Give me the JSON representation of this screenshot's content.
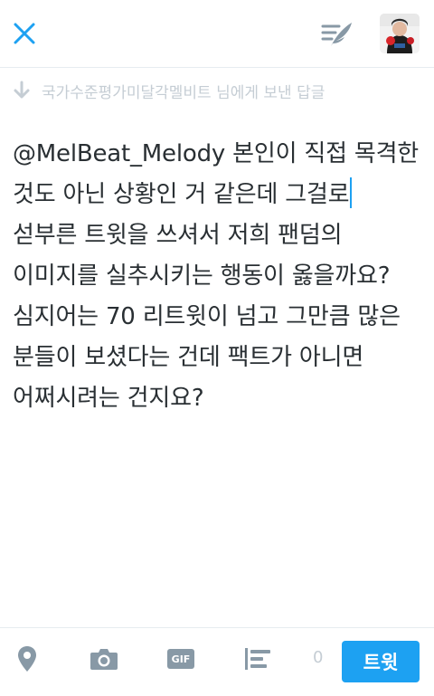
{
  "header": {
    "close_icon": "close-icon",
    "drafts_icon": "drafts-quill-icon",
    "avatar_icon": "user-avatar"
  },
  "reply_to": {
    "icon": "reply-arrow-icon",
    "text": "국가수준평가미달각멜비트 님에게 보낸 답글"
  },
  "compose": {
    "mention": "@MelBeat_Melody",
    "text_line1_rest": " 본인이 직접 목격한",
    "text_line2": "것도 아닌 상황인 거 같은데 그걸로",
    "text_line3": "섣부른 트윗을 쓰셔서 저희 팬덤의",
    "text_line4": "이미지를 실추시키는 행동이 옳을까요?",
    "text_line5": "심지어는 70 리트윗이 넘고 그만큼 많은",
    "text_line6": "분들이 보셨다는 건데 팩트가 아니면",
    "text_line7": "어쩌시려는 건지요?"
  },
  "toolbar": {
    "location_icon": "location-pin-icon",
    "camera_icon": "camera-icon",
    "gif_label": "GIF",
    "poll_icon": "poll-icon",
    "char_count": "0",
    "tweet_label": "트윗"
  },
  "colors": {
    "accent": "#1da1f2",
    "text": "#292f33",
    "muted": "#c5cdd4",
    "icon_gray": "#8899a6"
  }
}
